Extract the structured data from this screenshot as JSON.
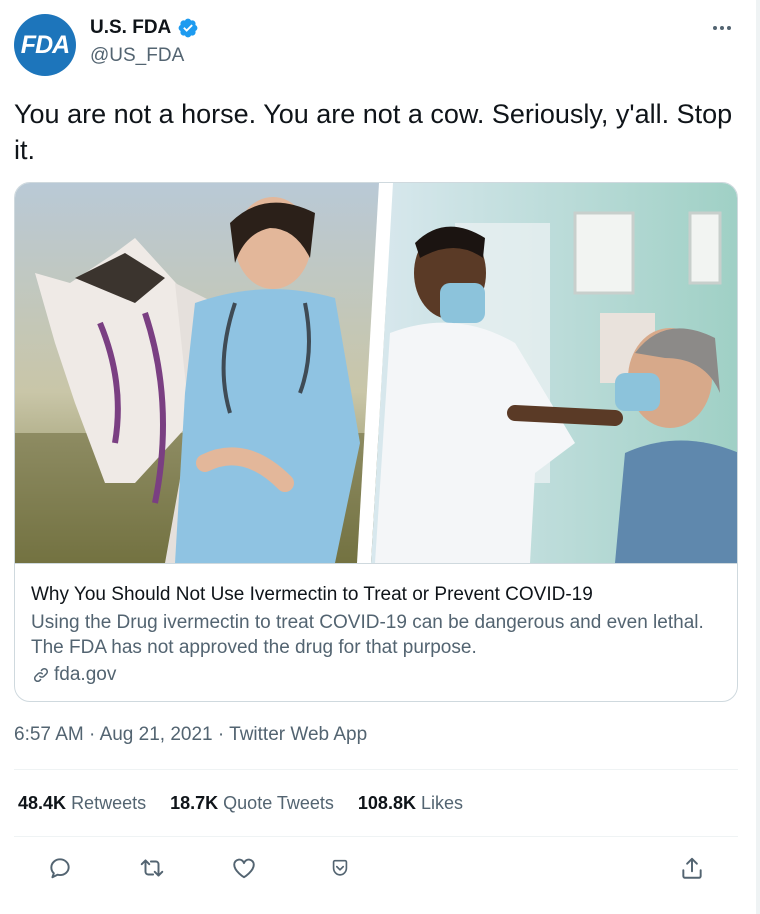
{
  "account": {
    "avatar_text": "FDA",
    "display_name": "U.S. FDA",
    "handle": "@US_FDA"
  },
  "tweet": {
    "text": "You are not a horse. You are not a cow. Seriously, y'all. Stop it."
  },
  "card": {
    "title": "Why You Should Not Use Ivermectin to Treat or Prevent COVID-19",
    "description": "Using the Drug ivermectin to treat COVID-19 can be dangerous and even lethal. The FDA has not approved the drug for that purpose.",
    "domain": "fda.gov"
  },
  "meta": {
    "time": "6:57 AM",
    "date": "Aug 21, 2021",
    "source": "Twitter Web App",
    "separator": "·"
  },
  "stats": {
    "retweets_count": "48.4K",
    "retweets_label": "Retweets",
    "quotes_count": "18.7K",
    "quotes_label": "Quote Tweets",
    "likes_count": "108.8K",
    "likes_label": "Likes"
  },
  "colors": {
    "accent": "#1d9bf0",
    "avatar_bg": "#1d75bb",
    "secondary_text": "#536471",
    "border": "#cfd9de"
  },
  "icons": {
    "verified": "verified-badge-icon",
    "more": "more-icon",
    "link": "link-icon",
    "reply": "reply-icon",
    "retweet": "retweet-icon",
    "like": "heart-icon",
    "bookmark": "bookmark-icon",
    "share": "share-icon"
  }
}
